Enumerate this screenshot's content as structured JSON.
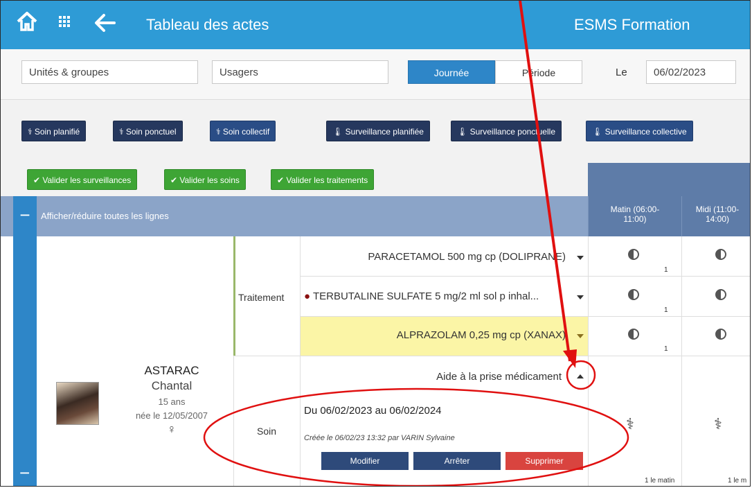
{
  "header": {
    "title": "Tableau des actes",
    "organization": "ESMS Formation"
  },
  "filters": {
    "units_placeholder": "Unités & groupes",
    "users_placeholder": "Usagers",
    "mode_day": "Journée",
    "mode_period": "Période",
    "date_label": "Le",
    "date_value": "06/02/2023"
  },
  "care_buttons": {
    "soin_planifie": "Soin planifié",
    "soin_ponctuel": "Soin ponctuel",
    "soin_collectif": "Soin collectif",
    "surv_planifiee": "Surveillance planifiée",
    "surv_ponctuelle": "Surveillance ponctuelle",
    "surv_collective": "Surveillance collective"
  },
  "validate_buttons": {
    "surveillances": "Valider les surveillances",
    "soins": "Valider les soins",
    "traitements": "Valider les traitements"
  },
  "grid": {
    "toggle_all_label": "Afficher/réduire toutes les lignes",
    "columns": [
      "Matin (06:00-\n11:00)",
      "Midi (11:00-\n14:00)"
    ]
  },
  "patient": {
    "last_name": "ASTARAC",
    "first_name": "Chantal",
    "age": "15 ans",
    "birth": "née le 12/05/2007",
    "sex_symbol": "♀"
  },
  "treatment": {
    "section_label": "Traitement",
    "rows": [
      {
        "name": "PARACETAMOL 500 mg cp (DOLIPRANE)",
        "count": "1"
      },
      {
        "name": "TERBUTALINE SULFATE 5 mg/2 ml sol p inhal...",
        "count": "1"
      },
      {
        "name": "ALPRAZOLAM 0,25 mg cp (XANAX)",
        "count": "1"
      }
    ]
  },
  "care": {
    "section_label": "Soin",
    "title": "Aide à la prise médicament",
    "dates": "Du 06/02/2023 au 06/02/2024",
    "created": "Créée le 06/02/23 13:32 par VARIN Sylvaine",
    "edit": "Modifier",
    "stop": "Arrêter",
    "delete": "Supprimer",
    "morning_count": "1 le matin",
    "noon_count": "1 le m"
  },
  "colors": {
    "header": "#2e9bd6",
    "band": "#8ba4c8",
    "delete": "#d9443f",
    "highlight": "#fbf5a6",
    "annotation": "#e01010"
  }
}
